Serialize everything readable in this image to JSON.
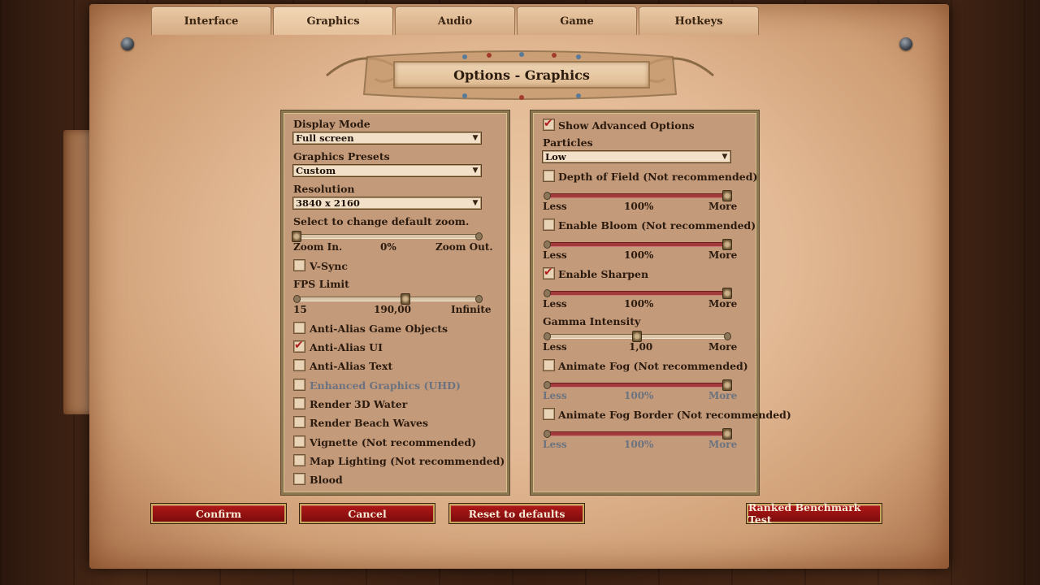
{
  "tabs": [
    {
      "label": "Interface"
    },
    {
      "label": "Graphics"
    },
    {
      "label": "Audio"
    },
    {
      "label": "Game"
    },
    {
      "label": "Hotkeys"
    }
  ],
  "active_tab": "Graphics",
  "title": "Options - Graphics",
  "left_panel": {
    "display_mode": {
      "label": "Display Mode",
      "value": "Full screen"
    },
    "graphics_presets": {
      "label": "Graphics Presets",
      "value": "Custom"
    },
    "resolution": {
      "label": "Resolution",
      "value": "3840 x 2160"
    },
    "zoom": {
      "label": "Select to change default zoom.",
      "min_label": "Zoom In.",
      "value_label": "0%",
      "max_label": "Zoom Out.",
      "level": 0
    },
    "vsync": {
      "label": "V-Sync",
      "checked": false
    },
    "fps_limit": {
      "label": "FPS Limit",
      "min_label": "15",
      "value_label": "190,00",
      "max_label": "Infinite",
      "level": 0.6
    },
    "checkboxes": [
      {
        "label": "Anti-Alias Game Objects",
        "checked": false,
        "disabled": false
      },
      {
        "label": "Anti-Alias UI",
        "checked": true,
        "disabled": false
      },
      {
        "label": "Anti-Alias Text",
        "checked": false,
        "disabled": false
      },
      {
        "label": "Enhanced Graphics (UHD)",
        "checked": false,
        "disabled": true
      },
      {
        "label": "Render 3D Water",
        "checked": false,
        "disabled": false
      },
      {
        "label": "Render Beach Waves",
        "checked": false,
        "disabled": false
      },
      {
        "label": "Vignette (Not recommended)",
        "checked": false,
        "disabled": false
      },
      {
        "label": "Map Lighting (Not recommended)",
        "checked": false,
        "disabled": false
      },
      {
        "label": "Blood",
        "checked": false,
        "disabled": false
      }
    ]
  },
  "right_panel": {
    "show_advanced": {
      "label": "Show Advanced Options",
      "checked": true
    },
    "particles": {
      "label": "Particles",
      "value": "Low"
    },
    "sliders": [
      {
        "label": "Depth of Field (Not recommended)",
        "checked": false,
        "min_label": "Less",
        "value_label": "100%",
        "max_label": "More",
        "level": 1.0,
        "dim": false
      },
      {
        "label": "Enable Bloom (Not recommended)",
        "checked": false,
        "min_label": "Less",
        "value_label": "100%",
        "max_label": "More",
        "level": 1.0,
        "dim": false
      },
      {
        "label": "Enable Sharpen",
        "checked": true,
        "min_label": "Less",
        "value_label": "100%",
        "max_label": "More",
        "level": 1.0,
        "dim": false
      },
      {
        "label": "Animate Fog (Not recommended)",
        "checked": false,
        "min_label": "Less",
        "value_label": "100%",
        "max_label": "More",
        "level": 1.0,
        "dim": true
      },
      {
        "label": "Animate Fog Border (Not recommended)",
        "checked": false,
        "min_label": "Less",
        "value_label": "100%",
        "max_label": "More",
        "level": 1.0,
        "dim": true
      }
    ],
    "gamma": {
      "label": "Gamma Intensity",
      "min_label": "Less",
      "value_label": "1,00",
      "max_label": "More",
      "level": 0.5
    }
  },
  "buttons": {
    "confirm": "Confirm",
    "cancel": "Cancel",
    "reset": "Reset to defaults",
    "benchmark": "Ranked Benchmark Test"
  },
  "colors": {
    "button_red": "#9a1212",
    "checkmark_red": "#b01e1e",
    "parchment": "#e2b994"
  }
}
